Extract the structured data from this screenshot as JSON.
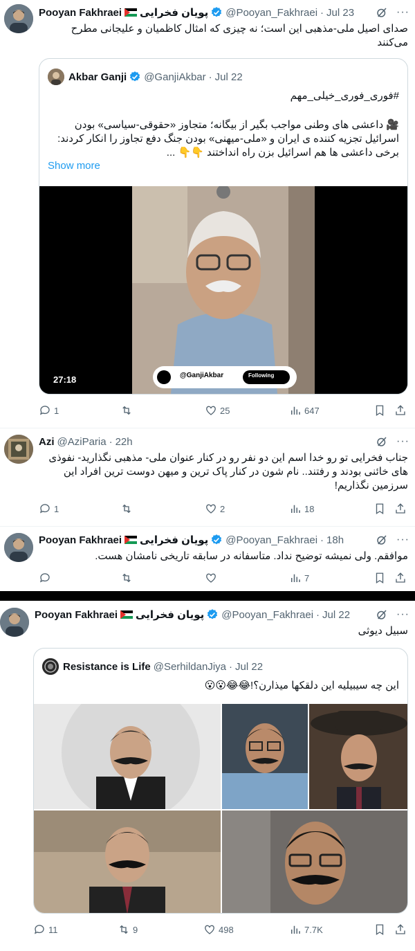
{
  "tweets": [
    {
      "name": "Pooyan Fakhraei",
      "name_fa": "پویان فخرایی",
      "handle": "@Pooyan_Fakhraei",
      "time": "Jul 23",
      "text": "صدای اصیل ملی-مذهبی این است؛ نه چیزی که امثال کاظمیان و علیجانی مطرح می‌کنند",
      "quote": {
        "name": "Akbar Ganji",
        "handle": "@GanjiAkbar",
        "time": "Jul 22",
        "hashtag": "#فوری_فوری_خیلی_مهم",
        "text": "🎥 داعشی های وطنی مواجب بگیر از بیگانه؛ متجاوز «حقوقی-سیاسی» بودن اسرائیل تجزیه کننده ی ایران و «ملی-میهنی» بودن جنگ دفع تجاوز را انکار کردند: برخی داعشی ها هم اسرائیل بزن راه انداختند 👇👇 ...",
        "show_more": "Show more",
        "video_duration": "27:18",
        "video_handle": "@GanjiAkbar",
        "video_following": "Following"
      },
      "stats": {
        "replies": "1",
        "retweets": "",
        "likes": "25",
        "views": "647"
      }
    },
    {
      "name": "Azi",
      "handle": "@AziParia",
      "time": "22h",
      "text": "جناب فخرایی تو رو خدا اسم این دو نفر رو در کنار عنوان ملی- مذهبی نگذارید- نفوذی های خائنی بودند و رفتند.. نام شون در کنار پاک ترین و میهن دوست ترین افراد این سرزمین نگذاریم!",
      "stats": {
        "replies": "1",
        "retweets": "",
        "likes": "2",
        "views": "18"
      }
    },
    {
      "name": "Pooyan Fakhraei",
      "name_fa": "پویان فخرایی",
      "handle": "@Pooyan_Fakhraei",
      "time": "18h",
      "text": "موافقم. ولی نمیشه توضیح نداد. متاسفانه در سابقه تاریخی نامشان هست.",
      "stats": {
        "replies": "",
        "retweets": "",
        "likes": "",
        "views": "7"
      }
    },
    {
      "name": "Pooyan Fakhraei",
      "name_fa": "پویان فخرایی",
      "handle": "@Pooyan_Fakhraei",
      "time": "Jul 22",
      "text": "سبیل دیوثی",
      "quote": {
        "name": "Resistance is Life",
        "handle": "@SerhildanJiya",
        "time": "Jul 22",
        "text": "این چه سیبیلیه این دلقکها میذارن؟!😂😂😮😮"
      },
      "stats": {
        "replies": "11",
        "retweets": "9",
        "likes": "498",
        "views": "7.7K"
      }
    }
  ],
  "colors": {
    "accent": "#1d9bf0",
    "muted": "#536471",
    "border": "#cfd9de"
  }
}
